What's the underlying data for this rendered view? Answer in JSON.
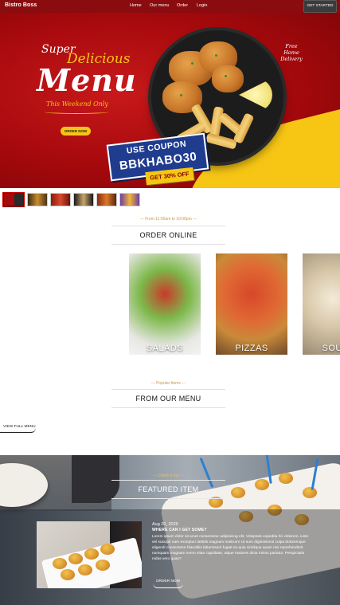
{
  "nav": {
    "brand": "Bistro Boss",
    "links": [
      "Home",
      "Our menu",
      "Order",
      "Login"
    ],
    "cta": "GET STARTED"
  },
  "hero": {
    "title_super": "Super",
    "title_delicious": "Delicious",
    "title_menu": "Menu",
    "title_weekend": "This Weekend Only",
    "order_button": "ORDER NOW",
    "free_delivery": "Free Home Delivery",
    "coupon_top": "USE COUPON",
    "coupon_code": "BBKHABO30",
    "discount": "GET 30% OFF",
    "slides": 6,
    "active_slide": 1
  },
  "order_online": {
    "subtitle": "--- From 11:00am to 10:00pm ---",
    "title": "ORDER ONLINE",
    "categories": [
      "SALADS",
      "PIZZAS",
      "SOUPS"
    ]
  },
  "our_menu": {
    "subtitle": "--- Popular Items ---",
    "title": "FROM OUR MENU",
    "view_full": "VIEW FULL MENU"
  },
  "featured": {
    "subtitle": "--- Check it out ---",
    "title": "FEATURED ITEM",
    "date": "Aug 20, 2029",
    "question": "WHERE CAN I GET SOME?",
    "body": "Lorem ipsum dolor sit amet consectetur adipisicing elit. Voluptate expedita hic dolorem, iusto vel suscipit nam excepturi debitis magnam nostrum! Ut eum dignissimos culpa doloremque eligendi consectetur blanditiis laboriosam fugiat ea quia similique quam nisi reprehenderit numquam magnam nemo vitae cupiditate, atque maiores dicta minus pariatur. Perspiciatis nobis vero quas?",
    "button": "ORDER NOW"
  },
  "colors": {
    "nav_bg": "#8a0c0f",
    "hero_red": "#a5090c",
    "accent_yellow": "#f7c614",
    "coupon_blue": "#1f3c8f",
    "gold_subtitle": "#c79a3a"
  }
}
